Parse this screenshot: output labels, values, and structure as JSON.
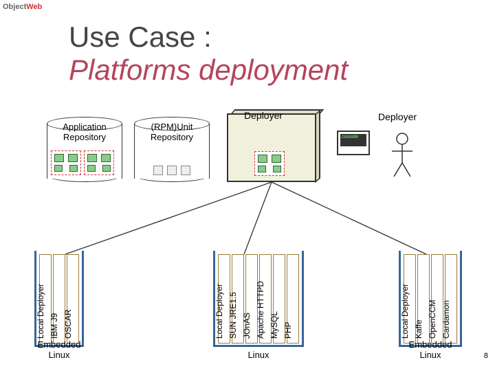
{
  "logo": {
    "part1": "Object",
    "part2": "Web"
  },
  "title": "Use Case :",
  "subtitle": "Platforms deployment",
  "cylinders": [
    {
      "label": "Application Repository"
    },
    {
      "label": "(RPM)Unit Repository"
    }
  ],
  "deployer_box": {
    "label": "Deployer"
  },
  "actor": {
    "label": "Deployer",
    "console": "console"
  },
  "hosts": [
    {
      "label": "Embedded Linux",
      "bars": [
        "Local Deployer",
        "IBM J9",
        "OSCAR"
      ]
    },
    {
      "label": "Linux",
      "bars": [
        "Local Deployer",
        "SUN JRE1.5",
        "JOnAS",
        "Apache HTTPD",
        "MySQL",
        "PHP"
      ]
    },
    {
      "label": "Embedded Linux",
      "bars": [
        "Local Deployer",
        "Kaffe",
        "OpenCCM",
        "Cardamon"
      ]
    }
  ],
  "pagenum": "8"
}
